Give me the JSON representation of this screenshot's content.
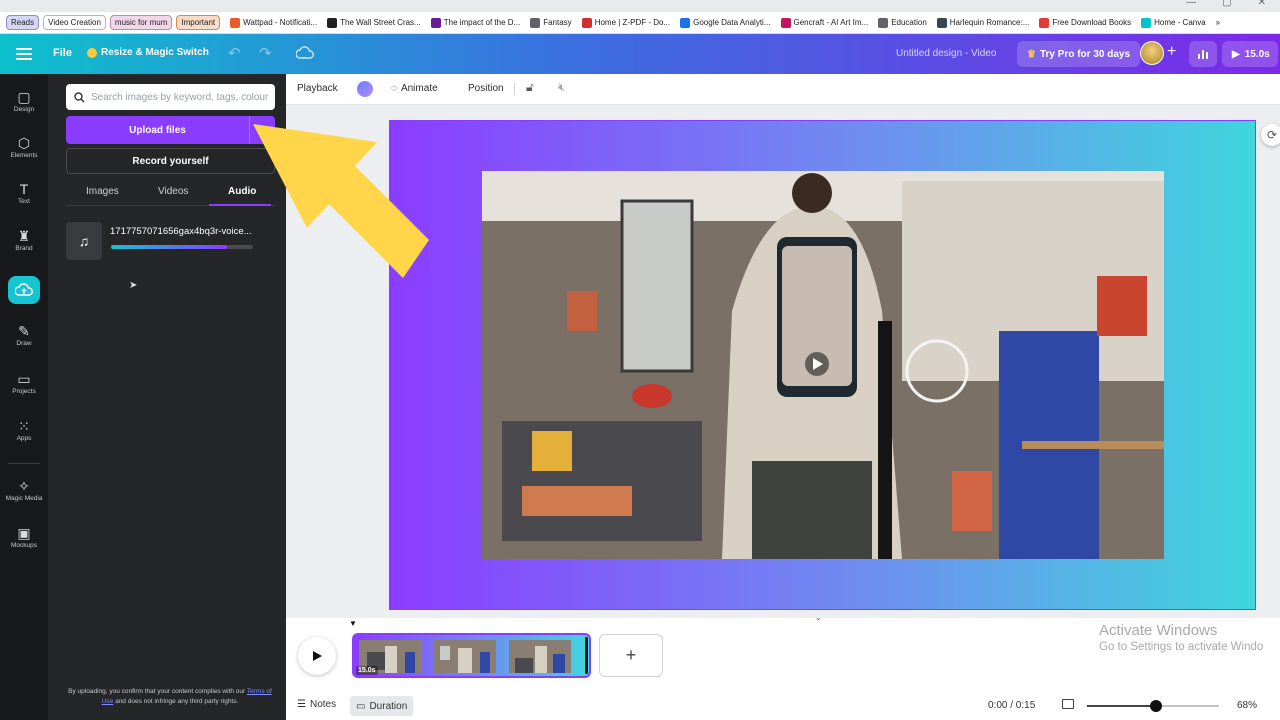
{
  "browser": {
    "bookmarks_pills": [
      "Reads",
      "Video Creation",
      "music for mum",
      "Important"
    ],
    "bookmarks": [
      {
        "label": "Wattpad - Notificati...",
        "color": "#ea5a2c"
      },
      {
        "label": "The Wall Street Cras...",
        "color": "#222222"
      },
      {
        "label": "The impact of the D...",
        "color": "#6a1b9a"
      },
      {
        "label": "Fantasy",
        "color": "#5f6368"
      },
      {
        "label": "Home | Z-PDF - Do...",
        "color": "#d32f2f"
      },
      {
        "label": "Google Data Analyti...",
        "color": "#1a73e8"
      },
      {
        "label": "Gencraft - AI Art Im...",
        "color": "#c2185b"
      },
      {
        "label": "Education",
        "color": "#5f6368"
      },
      {
        "label": "Harlequin Romance:...",
        "color": "#37474f"
      },
      {
        "label": "Free Download Books",
        "color": "#e53935"
      },
      {
        "label": "Home - Canva",
        "color": "#00c4cc"
      }
    ],
    "overflow": "»"
  },
  "header": {
    "file_label": "File",
    "resize_label": "Resize & Magic Switch",
    "doc_title": "Untitled design - Video",
    "pro_label": "Try Pro for 30 days",
    "duration_label": "15.0s",
    "gradient_colors": [
      "#0ec0cc",
      "#3b6fe0",
      "#7c2ae8"
    ]
  },
  "rail": {
    "items": [
      {
        "label": "Design",
        "icon": "design-icon",
        "glyph": "▢"
      },
      {
        "label": "Elements",
        "icon": "elements-icon",
        "glyph": "⬡"
      },
      {
        "label": "Text",
        "icon": "text-icon",
        "glyph": "T"
      },
      {
        "label": "Brand",
        "icon": "brand-icon",
        "glyph": "♜"
      },
      {
        "label": "Draw",
        "icon": "draw-icon",
        "glyph": "✎"
      },
      {
        "label": "Projects",
        "icon": "projects-icon",
        "glyph": "▭"
      },
      {
        "label": "Apps",
        "icon": "apps-icon",
        "glyph": "⁙"
      },
      {
        "label": "Magic Media",
        "icon": "magic-media-icon",
        "glyph": "✧"
      },
      {
        "label": "Mockups",
        "icon": "mockups-icon",
        "glyph": "▣"
      }
    ],
    "active_icon": "uploads-cloud-icon"
  },
  "panel": {
    "search_placeholder": "Search images by keyword, tags, colour",
    "upload_label": "Upload files",
    "upload_more": "···",
    "record_label": "Record yourself",
    "tabs": [
      "Images",
      "Videos",
      "Audio"
    ],
    "active_tab": "Audio",
    "audio_item": {
      "name": "1717757071656gax4bq3r-voice...",
      "progress": 0.82
    },
    "legal_text_1": "By uploading, you confirm that your content complies with our",
    "legal_link": "Terms of Use",
    "legal_text_2": "and does not infringe any third party rights."
  },
  "toolbar": {
    "playback_label": "Playback",
    "animate_label": "Animate",
    "position_label": "Position"
  },
  "timeline": {
    "clip_duration": "15.0s",
    "add_symbol": "+",
    "notes_label": "Notes",
    "duration_label": "Duration",
    "time_readout": "0:00 / 0:15",
    "zoom_label": "68%",
    "zoom_value": 0.52
  },
  "watermark": {
    "title": "Activate Windows",
    "subtitle": "Go to Settings to activate Windo"
  }
}
